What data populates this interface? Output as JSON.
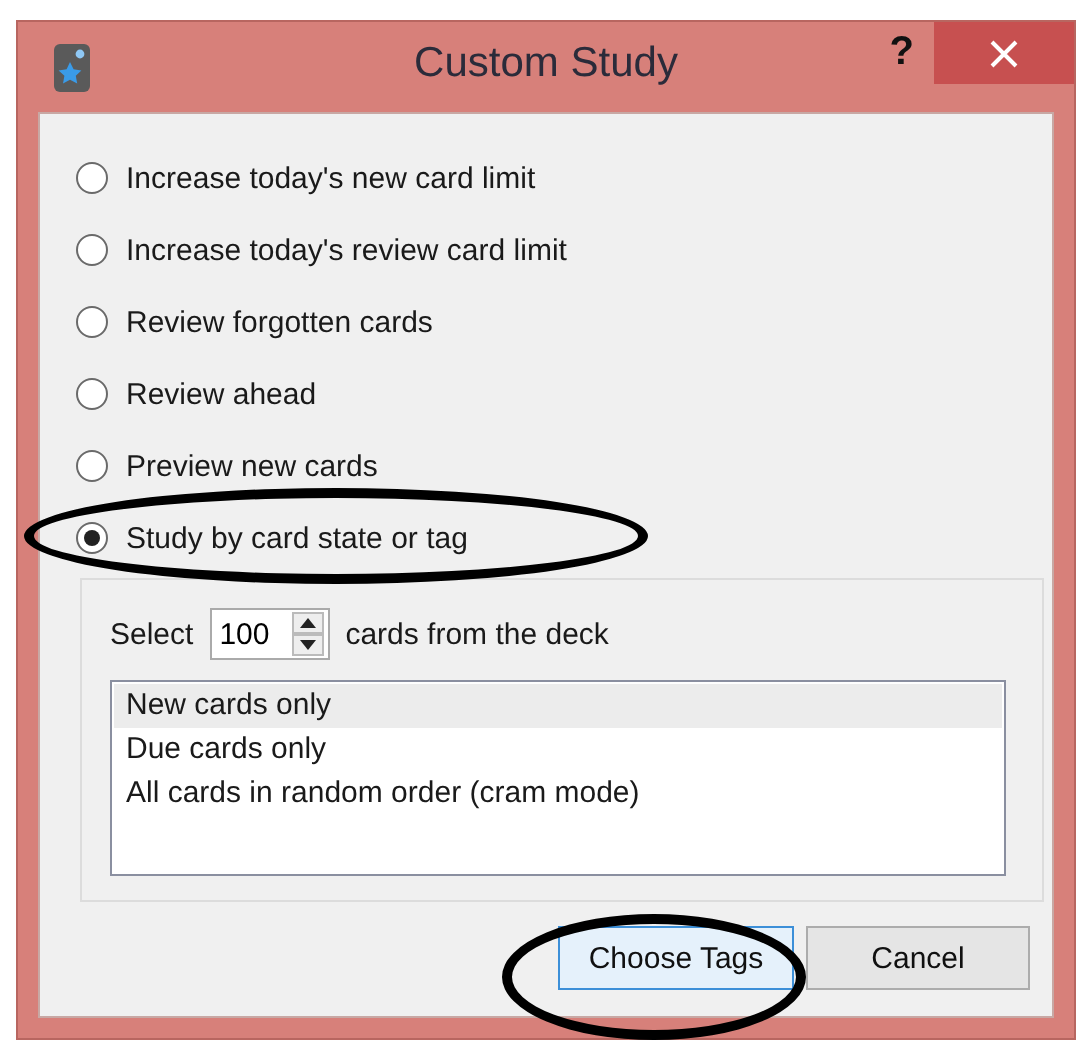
{
  "window": {
    "title": "Custom Study",
    "help": "?"
  },
  "options": [
    {
      "label": "Increase today's new card limit",
      "selected": false
    },
    {
      "label": "Increase today's review card limit",
      "selected": false
    },
    {
      "label": "Review forgotten cards",
      "selected": false
    },
    {
      "label": "Review ahead",
      "selected": false
    },
    {
      "label": "Preview new cards",
      "selected": false
    },
    {
      "label": "Study by card state or tag",
      "selected": true
    }
  ],
  "card_state": {
    "select_label": "Select",
    "count": "100",
    "suffix": "cards from the deck",
    "list": [
      {
        "label": "New cards only",
        "selected": true
      },
      {
        "label": "Due cards only",
        "selected": false
      },
      {
        "label": "All cards in random order (cram mode)",
        "selected": false
      }
    ]
  },
  "buttons": [
    {
      "label": "Choose Tags",
      "default": true
    },
    {
      "label": "Cancel",
      "default": false
    }
  ]
}
